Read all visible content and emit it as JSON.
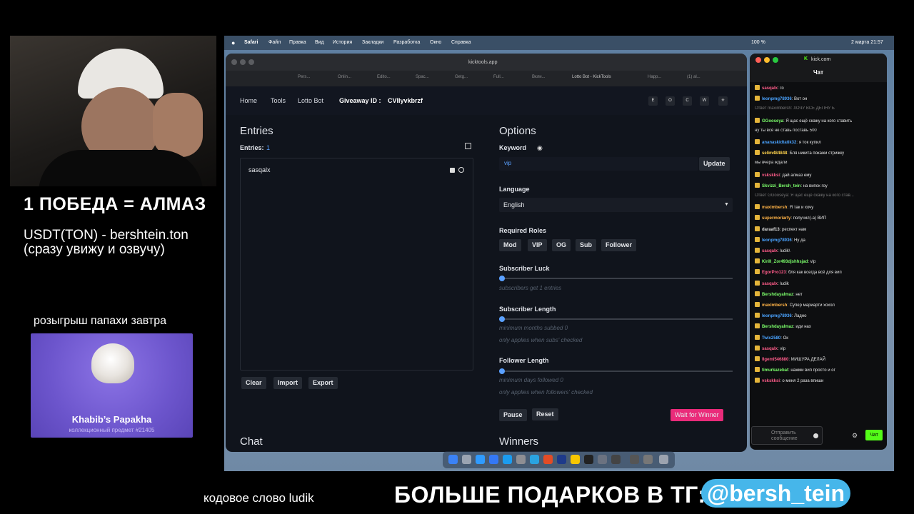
{
  "overlay": {
    "win_text": "1 ПОБЕДА = АЛМАЗ",
    "usdt_line1": "USDT(TON) - bershtein.ton",
    "usdt_line2": "(сразу увижу и озвучу)",
    "papaha_label": "розыгрыш папахи завтра",
    "papaha_name": "Khabib’s Papakha",
    "papaha_sub": "коллекционный предмет #21405",
    "codeword": "кодовое слово ludik",
    "promo": "БОЛЬШЕ ПОДАРКОВ В ТГ:",
    "handle": "@bersh_tein"
  },
  "menubar": {
    "app": "Safari",
    "items": [
      "Файл",
      "Правка",
      "Вид",
      "История",
      "Закладки",
      "Разработка",
      "Окно",
      "Справка"
    ],
    "battery": "100 %",
    "date": "2 марта 21:57"
  },
  "safari": {
    "url": "kicktools.app",
    "tabs": [
      "Pers...",
      "Onlin...",
      "Edito...",
      "Spac...",
      "Getg...",
      "Full...",
      "Вкли...",
      "Lotto Bot - KickTools",
      "Happ...",
      "(1) al..."
    ]
  },
  "app": {
    "nav": [
      "Home",
      "Tools",
      "Lotto Bot"
    ],
    "giveaway_label": "Giveaway ID :",
    "giveaway_id": "CVIlyvkbrzf",
    "nav_buttons": [
      "E",
      "O",
      "C",
      "W",
      "☀"
    ],
    "entries_title": "Entries",
    "entries_label": "Entries:",
    "entries_count": "1",
    "entry_name": "sasqalx",
    "entries_buttons": [
      "Clear",
      "Import",
      "Export"
    ],
    "chat_title": "Chat",
    "options_title": "Options",
    "keyword_label": "Keyword",
    "keyword_value": "vip",
    "update_label": "Update",
    "language_label": "Language",
    "language_value": "English",
    "roles_label": "Required Roles",
    "roles": [
      "Mod",
      "VIP",
      "OG",
      "Sub",
      "Follower"
    ],
    "sub_luck_label": "Subscriber Luck",
    "sub_luck_hint": "subscribers get 1 entries",
    "sub_length_label": "Subscriber Length",
    "sub_length_hint1": "minimum months subbed 0",
    "sub_length_hint2": "only applies when subs' checked",
    "follower_length_label": "Follower Length",
    "follower_length_hint1": "minimum days followed 0",
    "follower_length_hint2": "only applies when followers' checked",
    "pause_label": "Pause",
    "reset_label": "Reset",
    "wait_label": "Wait for Winner",
    "winners_title": "Winners"
  },
  "chat": {
    "site": "kick.com",
    "title": "Чат",
    "messages": [
      {
        "user": "sasqalx",
        "text": "го",
        "color": "#ff5c8a"
      },
      {
        "user": "leonpmg78936",
        "text": "Вот он",
        "color": "#4aa3ff"
      },
      {
        "user": "",
        "text": "Ответ maximbersh: ХОЧУ ВСЕ ДЕПНУ Ь",
        "color": "#777"
      },
      {
        "user": "GGooseya",
        "text": "Я щас ещё скажу на кого ставить",
        "color": "#7cff6b"
      },
      {
        "user": "",
        "text": "ну ты всё не ставь поставь 500",
        "color": "#ddd"
      },
      {
        "user": "ananaskidtatik32",
        "text": "я ток купил",
        "color": "#4aa3ff"
      },
      {
        "user": "selim484848",
        "text": "Бля никита покажи стрижку",
        "color": "#ffd34d"
      },
      {
        "user": "",
        "text": "мы вчера ждали",
        "color": "#ddd"
      },
      {
        "user": "vskskksi",
        "text": "дай алмаз ему",
        "color": "#ff5c8a"
      },
      {
        "user": "Skvizzi_Bersh_tein",
        "text": "на випок гоу",
        "color": "#7cff6b"
      },
      {
        "user": "",
        "text": "Ответ GGooseya: Я щас ещё скажу на кого став...",
        "color": "#777"
      },
      {
        "user": "maximbersh",
        "text": "Я так и хочу",
        "color": "#ffb347"
      },
      {
        "user": "supermoriarty",
        "text": "получил(-а) ВИП",
        "color": "#ffb347"
      },
      {
        "user": "daraaf13",
        "text": "респект нам",
        "color": "#ddd"
      },
      {
        "user": "leonpmg78936",
        "text": "Ну да",
        "color": "#4aa3ff"
      },
      {
        "user": "sasqalx",
        "text": "ludik\\",
        "color": "#ff5c8a"
      },
      {
        "user": "Kirill_Zor493djshhsjad",
        "text": "vip",
        "color": "#7cff6b"
      },
      {
        "user": "EgorPro123",
        "text": "бля как всегда всё для вип",
        "color": "#ff5c8a"
      },
      {
        "user": "sasqalx",
        "text": "ludik",
        "color": "#ff5c8a"
      },
      {
        "user": "Bershdayalmaz",
        "text": "нет",
        "color": "#7cff6b"
      },
      {
        "user": "maximbersh",
        "text": "Супер мариарти хохол",
        "color": "#ffb347"
      },
      {
        "user": "leonpmg78936",
        "text": "Ладно",
        "color": "#4aa3ff"
      },
      {
        "user": "Bershdayalmaz",
        "text": "иди нах",
        "color": "#7cff6b"
      },
      {
        "user": "Twix2580",
        "text": "Ок",
        "color": "#4aa3ff"
      },
      {
        "user": "sasqalx",
        "text": "vip",
        "color": "#ff5c8a"
      },
      {
        "user": "llgemi546880",
        "text": "МИШУРА ДЕЛАЙ",
        "color": "#ff5c8a"
      },
      {
        "user": "timurkazebat",
        "text": "нажми вип просто и ог",
        "color": "#7cff6b"
      },
      {
        "user": "vskskksi",
        "text": "о меня 2 раза впиши",
        "color": "#ff5c8a"
      }
    ],
    "input_placeholder": "Отправить сообщение",
    "send_label": "Чат"
  }
}
